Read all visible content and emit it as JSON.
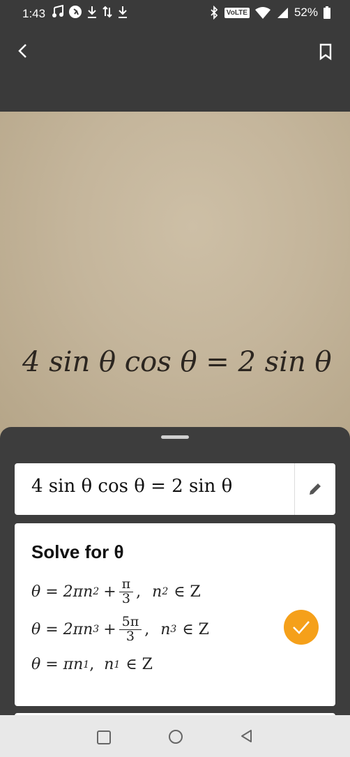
{
  "status_bar": {
    "time": "1:43",
    "network_badge": "VoLTE",
    "battery": "52%"
  },
  "photo": {
    "handwritten_equation": "4 sin θ cos θ = 2 sin θ"
  },
  "equation": {
    "text": "4 sin θ cos θ = 2 sin θ"
  },
  "solution": {
    "title": "Solve for θ",
    "lines": [
      {
        "lhs": "θ = 2πn",
        "sub": "2",
        "plus": "+",
        "num": "π",
        "den": "3",
        "cond_var": "n",
        "cond_sub": "2",
        "cond_set": "∈ Z"
      },
      {
        "lhs": "θ = 2πn",
        "sub": "3",
        "plus": "+",
        "num": "5π",
        "den": "3",
        "cond_var": "n",
        "cond_sub": "3",
        "cond_set": "∈ Z"
      },
      {
        "lhs": "θ = πn",
        "sub": "1",
        "cond_var": "n",
        "cond_sub": "1",
        "cond_set": "∈ Z"
      }
    ]
  },
  "colors": {
    "accent": "#f5a01a",
    "toolbar": "#3a3a3a",
    "paper": "#c4b59b"
  }
}
